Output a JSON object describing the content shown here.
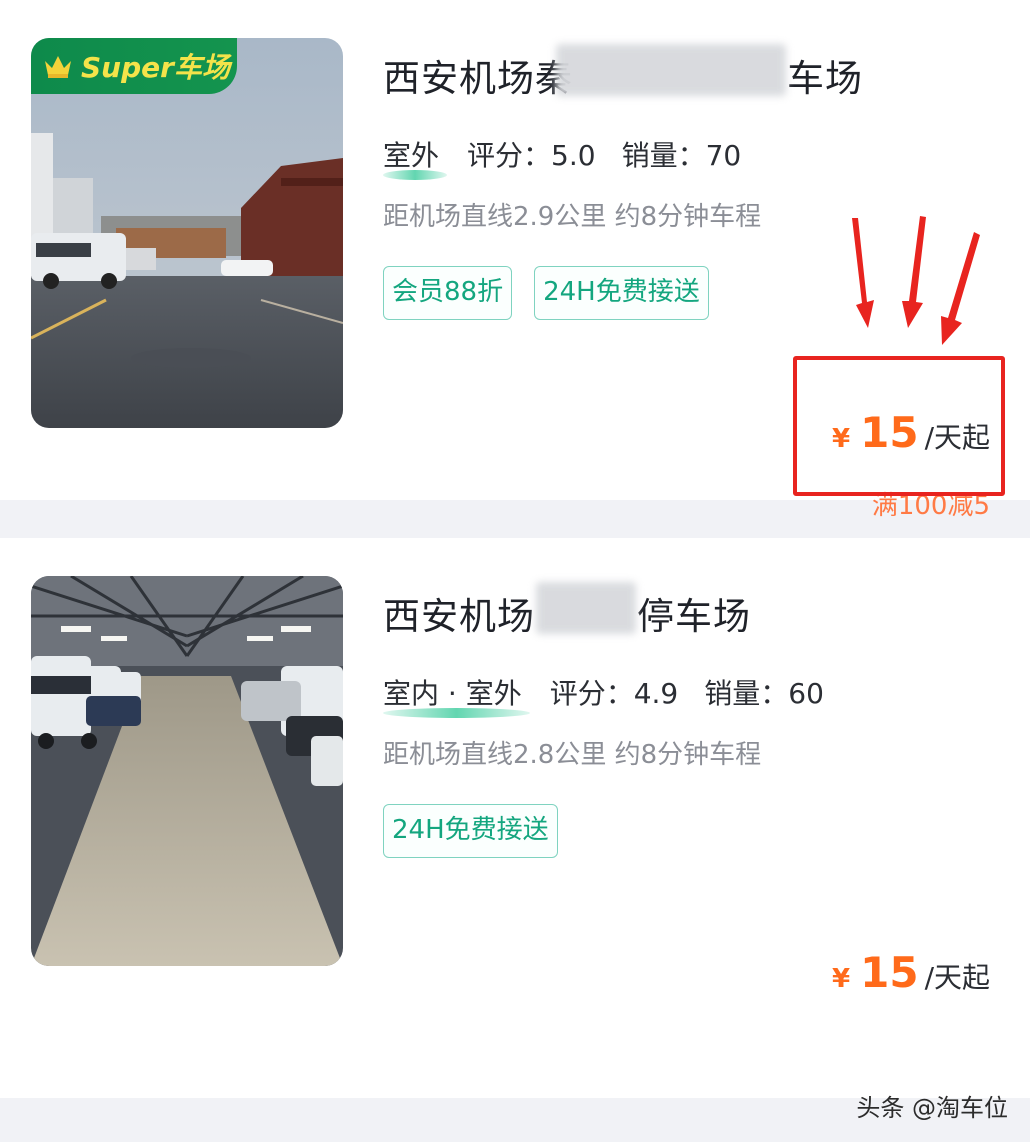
{
  "listings": [
    {
      "badge": "Super车场",
      "title": "西安机场秦",
      "title_suffix": "车场",
      "location": "室外",
      "rating_label": "评分：",
      "rating": "5.0",
      "sales_label": "销量：",
      "sales": "70",
      "distance": "距机场直线2.9公里 约8分钟车程",
      "tags": [
        "会员88折",
        "24H免费接送"
      ],
      "currency": "¥",
      "price": "15",
      "price_unit": "/天起"
    },
    {
      "title": "西安机场",
      "title_suffix": "停车场",
      "location": "室内 · 室外",
      "rating_label": "评分：",
      "rating": "4.9",
      "sales_label": "销量：",
      "sales": "60",
      "distance": "距机场直线2.8公里 约8分钟车程",
      "tags": [
        "24H免费接送"
      ],
      "currency": "¥",
      "price": "15",
      "price_unit": "/天起",
      "discount": "满100减5"
    }
  ],
  "watermark": "头条 @淘车位",
  "colors": {
    "price": "#ff6a1a",
    "tag_text": "#14a67f",
    "tag_border": "#7fd3c0",
    "highlight": "#e8241f",
    "badge_bg": "#0e8a4b",
    "badge_text": "#f4e34a"
  }
}
